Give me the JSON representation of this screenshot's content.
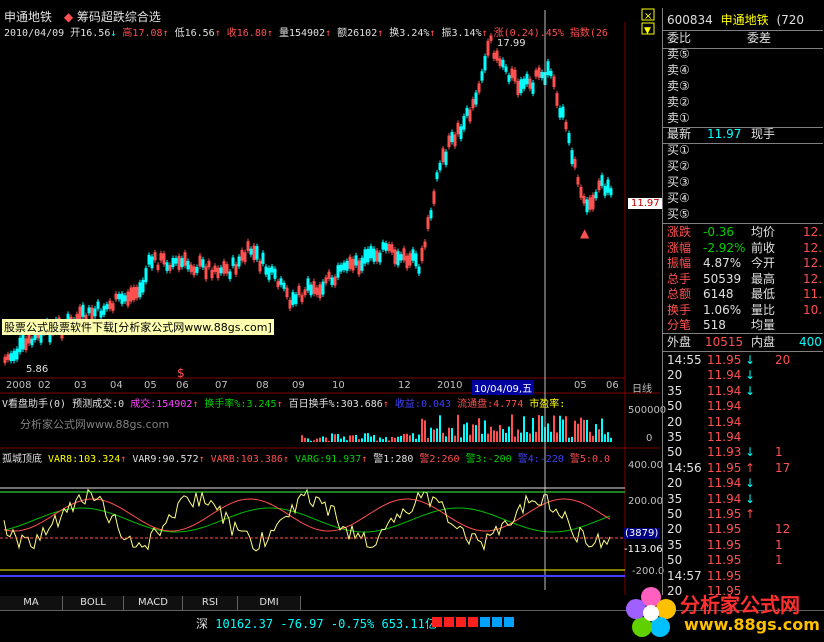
{
  "header": {
    "stock_name": "申通地铁",
    "formula_name": "筹码超跌综合选",
    "ohlc": {
      "date": "2010/04/09",
      "open_label": "开",
      "open": "16.56",
      "high_label": "高",
      "high": "17.08",
      "low_label": "低",
      "low": "16.56",
      "close_label": "收",
      "close": "16.80",
      "vol_label": "量",
      "vol": "154902",
      "amt_label": "额",
      "amt": "26102",
      "turn_label": "换",
      "turn": "3.24%",
      "amp_label": "振",
      "amp": "3.14%",
      "chg_label": "涨",
      "chg": "(0.24)",
      "chg_pct": ".45%",
      "index_label": "指数",
      "index_val": "(26"
    },
    "high_marker": "17.99",
    "low_marker": "5.86",
    "price_tag": "11.97",
    "ad_banner": "股票公式股票软件下载[分析家公式网www.88gs.com]",
    "dollar_marker": "$"
  },
  "x_axis": {
    "labels": [
      "2008",
      "02",
      "03",
      "04",
      "05",
      "06",
      "07",
      "08",
      "09",
      "10",
      "12",
      "2010"
    ],
    "cursor_date": "10/04/09,五",
    "tail_labels": [
      "05",
      "06"
    ],
    "period": "日线"
  },
  "volume_panel": {
    "title": "V看盘助手(0)",
    "pred_label": "预测成交:0",
    "vol_label": "成交:",
    "vol": "154902",
    "turn_label": "换手率%:",
    "turn": "3.245",
    "hundred_label": "百日换手%:",
    "hundred": "303.686",
    "income_label": "收益:",
    "income": "0.043",
    "float_label": "流通盘:",
    "float": "4.774",
    "pe_label": "市盈率:",
    "watermark": "分析家公式网www.88gs.com",
    "y_max": "500000",
    "y_min": "0"
  },
  "indicator_panel": {
    "title": "孤城顶底",
    "var8_label": "VAR8:",
    "var8": "103.324",
    "var9_label": "VAR9:",
    "var9": "90.572",
    "varb_label": "VARB:",
    "varb": "103.386",
    "varg_label": "VARG:",
    "varg": "91.937",
    "w1_label": "警1:",
    "w1": "280",
    "w2_label": "警2:",
    "w2": "260",
    "w3_label": "警3:",
    "w3": "-200",
    "w4_label": "警4:",
    "w4": "-220",
    "w5_label": "警5:",
    "w5": "0.0",
    "y_labels": [
      "400.00",
      "200.00",
      "-113.06",
      "-200.0"
    ],
    "cursor_val": "(3879)"
  },
  "bottom_tabs": [
    "MA",
    "BOLL",
    "MACD",
    "RSI",
    "DMI"
  ],
  "status": {
    "market": "深",
    "index": "10162.37",
    "chg": "-76.97",
    "pct": "-0.75%",
    "amount": "653.11亿",
    "logo": "分析家公式网",
    "logo_url": "www.88gs.com"
  },
  "quote": {
    "code": "600834",
    "name": "申通地铁",
    "code_suffix": "(720",
    "wb_label": "委比",
    "wc_label": "委差",
    "sells": [
      "卖⑤",
      "卖④",
      "卖③",
      "卖②",
      "卖①"
    ],
    "last_label": "最新",
    "last": "11.97",
    "cur_label": "现手",
    "buys": [
      "买①",
      "买②",
      "买③",
      "买④",
      "买⑤"
    ],
    "stats": [
      {
        "l1": "涨跌",
        "v1": "-0.36",
        "l2": "均价",
        "v2": "12."
      },
      {
        "l1": "涨幅",
        "v1": "-2.92%",
        "l2": "前收",
        "v2": "12."
      },
      {
        "l1": "振幅",
        "v1": "4.87%",
        "l2": "今开",
        "v2": "12."
      },
      {
        "l1": "总手",
        "v1": "50539",
        "l2": "最高",
        "v2": "12."
      },
      {
        "l1": "总额",
        "v1": "6148",
        "l2": "最低",
        "v2": "11."
      },
      {
        "l1": "换手",
        "v1": "1.06%",
        "l2": "量比",
        "v2": "10."
      },
      {
        "l1": "分笔",
        "v1": "518",
        "l2": "均量",
        "v2": ""
      }
    ],
    "outer_label": "外盘",
    "outer": "10515",
    "inner_label": "内盘",
    "inner": "400"
  },
  "ticks": [
    {
      "t": "14:55",
      "p": "11.95",
      "d": "↓",
      "v": "20"
    },
    {
      "t": "20",
      "p": "11.94",
      "d": "↓",
      "v": ""
    },
    {
      "t": "35",
      "p": "11.94",
      "d": "↓",
      "v": ""
    },
    {
      "t": "50",
      "p": "11.94",
      "d": "",
      "v": ""
    },
    {
      "t": "20",
      "p": "11.94",
      "d": "",
      "v": ""
    },
    {
      "t": "35",
      "p": "11.94",
      "d": "",
      "v": ""
    },
    {
      "t": "50",
      "p": "11.93",
      "d": "↓",
      "v": "1"
    },
    {
      "t": "14:56",
      "p": "11.95",
      "d": "↑",
      "v": "17"
    },
    {
      "t": "20",
      "p": "11.94",
      "d": "↓",
      "v": ""
    },
    {
      "t": "35",
      "p": "11.94",
      "d": "↓",
      "v": ""
    },
    {
      "t": "50",
      "p": "11.95",
      "d": "↑",
      "v": ""
    },
    {
      "t": "20",
      "p": "11.95",
      "d": "",
      "v": "12"
    },
    {
      "t": "35",
      "p": "11.95",
      "d": "",
      "v": "1"
    },
    {
      "t": "50",
      "p": "11.95",
      "d": "",
      "v": "1"
    },
    {
      "t": "14:57",
      "p": "11.95",
      "d": "",
      "v": ""
    },
    {
      "t": "20",
      "p": "11.95",
      "d": "",
      "v": ""
    }
  ],
  "colors": {
    "up": "#ff5050",
    "down": "#00ffff",
    "bg": "#000000",
    "grid": "#800000"
  }
}
